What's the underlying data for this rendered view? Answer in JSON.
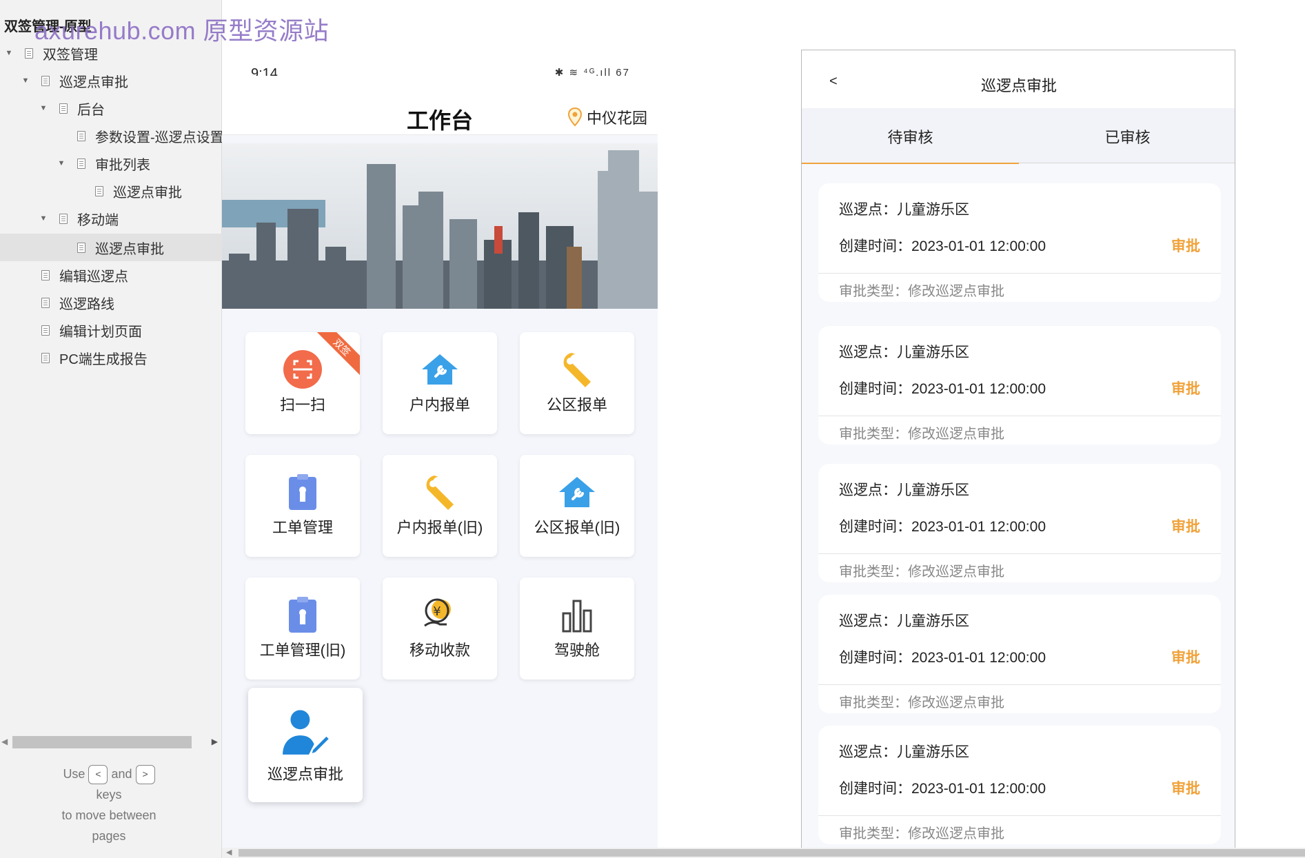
{
  "sidebar": {
    "project_title": "双签管理-原型",
    "watermark": "axurehub.com 原型资源站",
    "tree": [
      {
        "label": "双签管理",
        "toggle": "▼"
      },
      {
        "label": "巡逻点审批",
        "toggle": "▼"
      },
      {
        "label": "后台",
        "toggle": "▼"
      },
      {
        "label": "参数设置-巡逻点设置",
        "toggle": ""
      },
      {
        "label": "审批列表",
        "toggle": "▼"
      },
      {
        "label": "巡逻点审批",
        "toggle": ""
      },
      {
        "label": "移动端",
        "toggle": "▼"
      },
      {
        "label": "巡逻点审批",
        "toggle": ""
      },
      {
        "label": "编辑巡逻点",
        "toggle": ""
      },
      {
        "label": "巡逻路线",
        "toggle": ""
      },
      {
        "label": "编辑计划页面",
        "toggle": ""
      },
      {
        "label": "PC端生成报告",
        "toggle": ""
      }
    ],
    "hint": {
      "use": "Use",
      "and": "and",
      "keys": "keys",
      "line3": "to move between",
      "line4": "pages",
      "key_prev": "<",
      "key_next": ">"
    }
  },
  "phone": {
    "status_time": "9:14",
    "status_icons": "✱ ≋ ⁴ᴳ.ıll 67",
    "title": "工作台",
    "location": "中仪花园",
    "ribbon": "双签",
    "tiles": [
      {
        "label": "扫一扫",
        "icon": "scan-icon"
      },
      {
        "label": "户内报单",
        "icon": "house-wrench-icon"
      },
      {
        "label": "公区报单",
        "icon": "wrench-icon"
      },
      {
        "label": "工单管理",
        "icon": "clipboard-icon"
      },
      {
        "label": "户内报单(旧)",
        "icon": "wrench-icon"
      },
      {
        "label": "公区报单(旧)",
        "icon": "house-wrench-icon"
      },
      {
        "label": "工单管理(旧)",
        "icon": "clipboard-icon"
      },
      {
        "label": "移动收款",
        "icon": "payment-icon"
      },
      {
        "label": "驾驶舱",
        "icon": "bar-chart-icon"
      },
      {
        "label": "巡逻点审批",
        "icon": "user-edit-icon"
      }
    ]
  },
  "review": {
    "back": "<",
    "title": "巡逻点审批",
    "tabs": [
      "待审核",
      "已审核"
    ],
    "cards": [
      {
        "point": "巡逻点：儿童游乐区",
        "created": "创建时间：2023-01-01 12:00:00",
        "action": "审批",
        "type": "审批类型：修改巡逻点审批"
      },
      {
        "point": "巡逻点：儿童游乐区",
        "created": "创建时间：2023-01-01 12:00:00",
        "action": "审批",
        "type": "审批类型：修改巡逻点审批"
      },
      {
        "point": "巡逻点：儿童游乐区",
        "created": "创建时间：2023-01-01 12:00:00",
        "action": "审批",
        "type": "审批类型：修改巡逻点审批"
      },
      {
        "point": "巡逻点：儿童游乐区",
        "created": "创建时间：2023-01-01 12:00:00",
        "action": "审批",
        "type": "审批类型：修改巡逻点审批"
      },
      {
        "point": "巡逻点：儿童游乐区",
        "created": "创建时间：2023-01-01 12:00:00",
        "action": "审批",
        "type": "审批类型：修改巡逻点审批"
      }
    ]
  },
  "colors": {
    "accent": "#f0a23a",
    "ribbon": "#f06a3f",
    "icon_blue": "#3aa0e8",
    "icon_yellow": "#f5b72a",
    "icon_purple": "#6a8ee8"
  }
}
